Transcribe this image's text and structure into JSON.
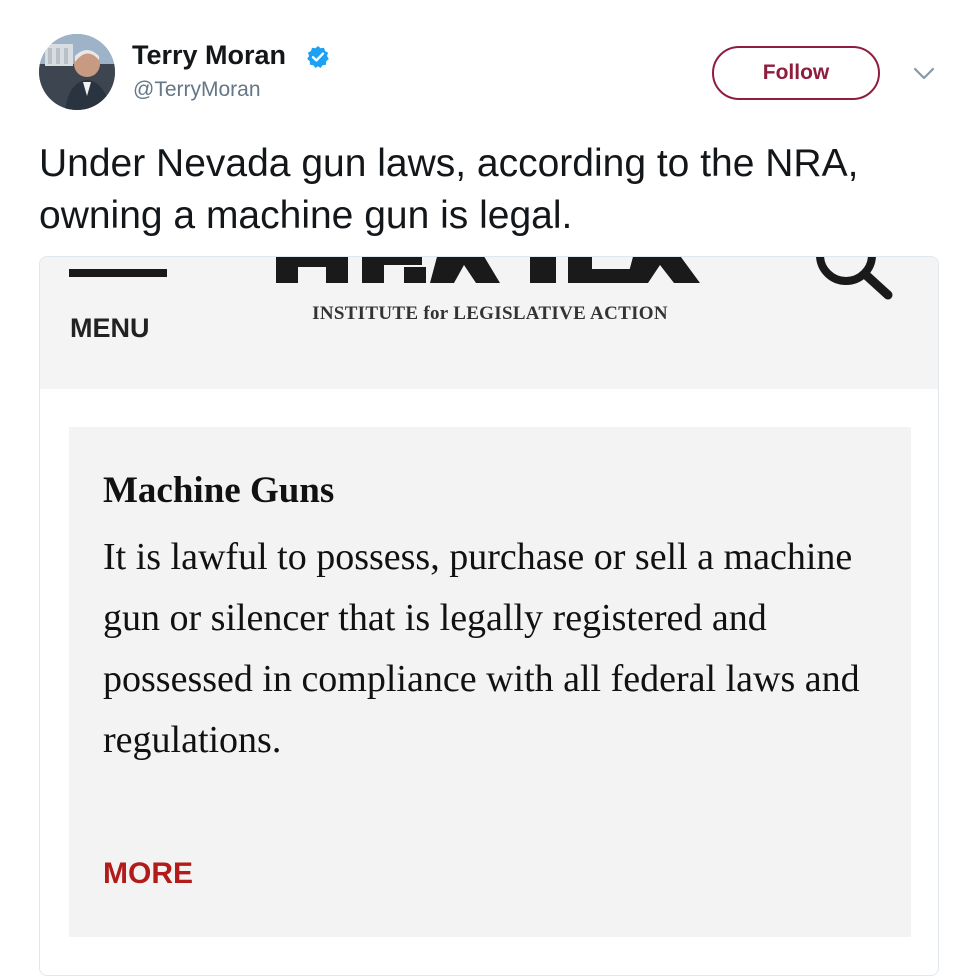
{
  "tweet": {
    "user_name": "Terry Moran",
    "user_handle": "@TerryMoran",
    "follow_label": "Follow",
    "text": "Under Nevada gun laws, according to the NRA, owning a machine gun is legal."
  },
  "embed": {
    "site": {
      "menu_label": "MENU",
      "logo_wordmark": "NRA ILA",
      "logo_subtitle": "INSTITUTE for LEGISLATIVE ACTION"
    },
    "content": {
      "title": "Machine Guns",
      "body": "It is lawful to possess, purchase or sell a machine gun or silencer that is legally registered and possessed in compliance with all federal laws and regulations.",
      "more_label": "MORE"
    }
  },
  "colors": {
    "follow_accent": "#8f1d3e",
    "verified_badge": "#1da1f2",
    "more_link": "#b31b1b",
    "card_background": "#f3f3f3"
  },
  "icons": [
    "verified-badge-icon",
    "chevron-down-icon",
    "hamburger-menu-icon",
    "search-icon"
  ]
}
